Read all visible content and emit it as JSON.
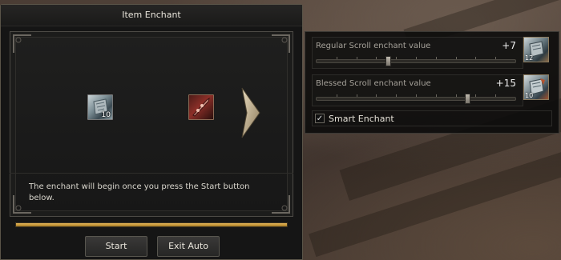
{
  "window": {
    "title": "Item Enchant",
    "description": "The enchant will begin once you press the Start button below.",
    "scroll_slot_count": "10",
    "progress": 1.0,
    "buttons": {
      "start": "Start",
      "exit_auto": "Exit Auto"
    }
  },
  "side_panel": {
    "regular": {
      "label": "Regular Scroll enchant value",
      "value": "+7",
      "slider_fraction": 0.36,
      "count": "12"
    },
    "blessed": {
      "label": "Blessed Scroll enchant value",
      "value": "+15",
      "slider_fraction": 0.76,
      "count": "10"
    },
    "smart_enchant": {
      "label": "Smart Enchant",
      "checked": true,
      "check_glyph": "✓"
    }
  },
  "icons": [
    "enchant-scroll-icon",
    "weapon-item-icon",
    "arrow-right-icon",
    "checkmark-icon"
  ],
  "colors": {
    "progress": "#d9a443",
    "accent": "#c8b58a"
  }
}
